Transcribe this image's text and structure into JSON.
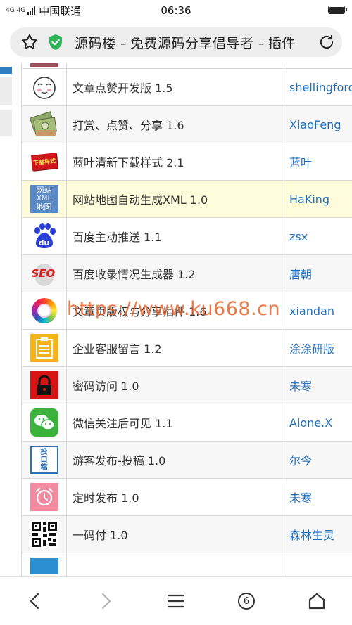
{
  "status": {
    "network": "4G 4G",
    "carrier": "中国联通",
    "time": "06:36"
  },
  "address_bar": {
    "title": "源码楼 - 免费源码分享倡导者 - 插件"
  },
  "plugins": [
    {
      "name": "文章点赞开发版 1.5",
      "author": "shellingford",
      "icon": "smiley-face-icon"
    },
    {
      "name": "打赏、点赞、分享 1.6",
      "author": "XiaoFeng",
      "icon": "money-icon"
    },
    {
      "name": "蓝叶清新下载样式 2.1",
      "author": "蓝叶",
      "icon": "download-badge-icon",
      "badge_text": "下载样式"
    },
    {
      "name": "网站地图自动生成XML 1.0",
      "author": "HaKing",
      "icon": "sitemap-icon",
      "badge_lines": [
        "网站",
        "XML",
        "地图"
      ]
    },
    {
      "name": "百度主动推送 1.1",
      "author": "zsx",
      "icon": "baidu-paw-icon",
      "badge_text": "du"
    },
    {
      "name": "百度收录情况生成器 1.2",
      "author": "唐朝",
      "icon": "seo-icon",
      "badge_text": "SEO"
    },
    {
      "name": "文章页版权与分享插件 1.6",
      "author": "xiandan",
      "icon": "color-wheel-icon"
    },
    {
      "name": "企业客服留言 1.2",
      "author": "涂涂研版",
      "icon": "clipboard-icon"
    },
    {
      "name": "密码访问 1.0",
      "author": "未寒",
      "icon": "lock-icon"
    },
    {
      "name": "微信关注后可见 1.1",
      "author": "Alone.X",
      "icon": "wechat-icon"
    },
    {
      "name": "游客发布-投稿 1.0",
      "author": "尔今",
      "icon": "submit-icon",
      "badge_lines": [
        "投",
        "口",
        "稿"
      ]
    },
    {
      "name": "定时发布 1.0",
      "author": "未寒",
      "icon": "alarm-clock-icon"
    },
    {
      "name": "一码付 1.0",
      "author": "森林生灵",
      "icon": "qr-code-icon"
    }
  ],
  "watermark": "https://www.ku668.cn",
  "bottom_nav": {
    "tab_count": "6"
  },
  "colors": {
    "link": "#1f6fbf",
    "highlight_row": "#fffcdb",
    "watermark": "#e9622a"
  }
}
